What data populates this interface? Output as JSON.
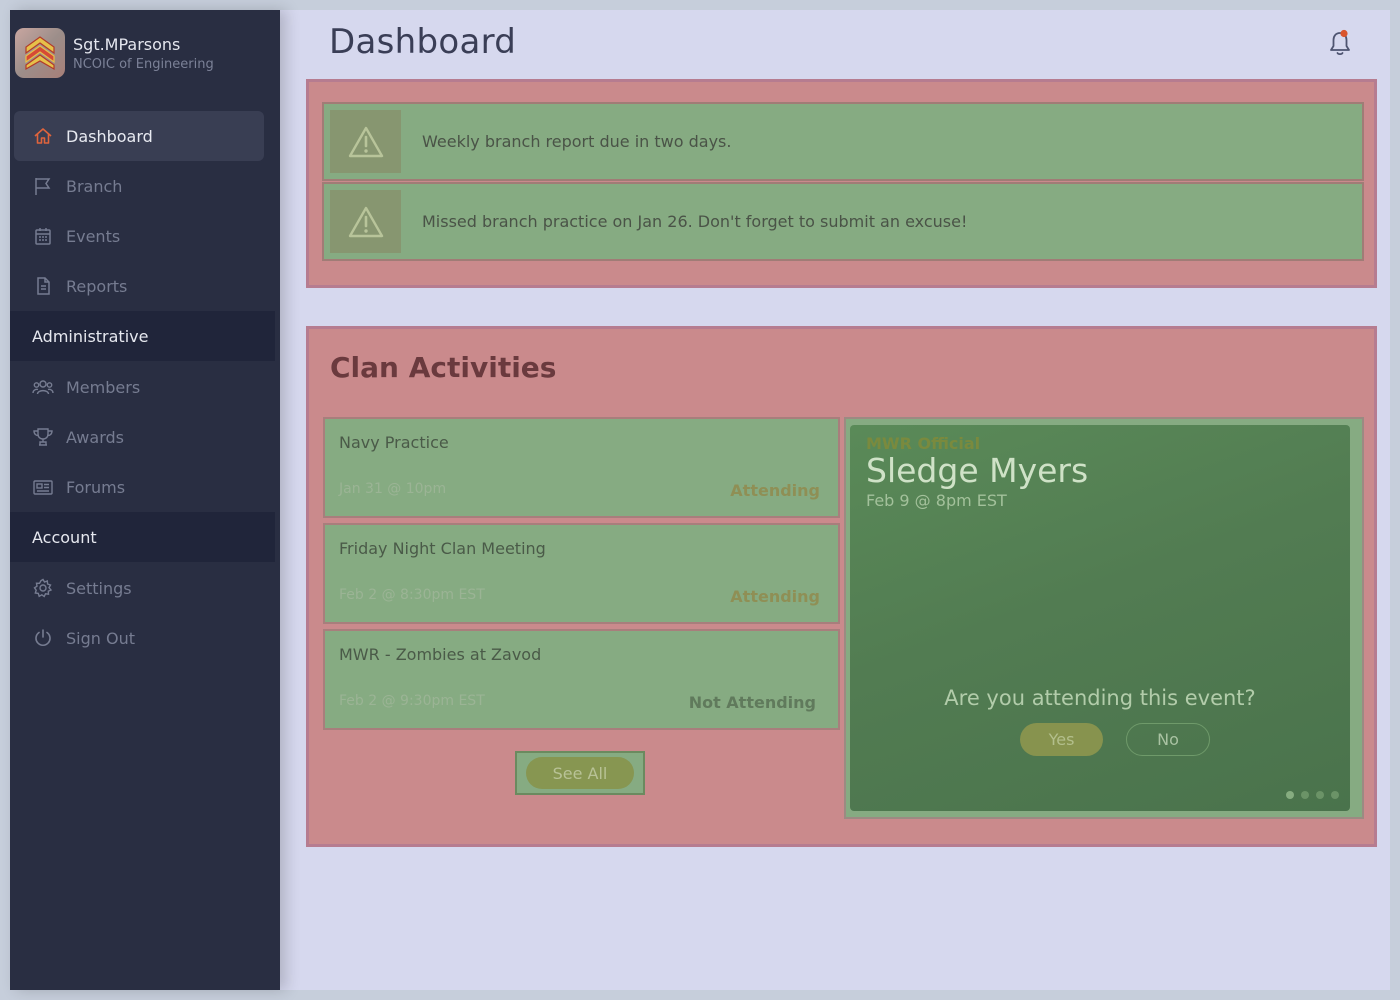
{
  "user": {
    "name": "Sgt.MParsons",
    "role": "NCOIC of Engineering"
  },
  "nav": {
    "main": [
      {
        "label": "Dashboard",
        "icon": "home-icon",
        "active": true
      },
      {
        "label": "Branch",
        "icon": "flag-icon"
      },
      {
        "label": "Events",
        "icon": "calendar-icon"
      },
      {
        "label": "Reports",
        "icon": "document-icon"
      }
    ],
    "administrative_header": "Administrative",
    "administrative": [
      {
        "label": "Members",
        "icon": "users-icon"
      },
      {
        "label": "Awards",
        "icon": "trophy-icon"
      },
      {
        "label": "Forums",
        "icon": "newspaper-icon"
      }
    ],
    "account_header": "Account",
    "account": [
      {
        "label": "Settings",
        "icon": "gear-icon"
      },
      {
        "label": "Sign Out",
        "icon": "power-icon"
      }
    ]
  },
  "page": {
    "title": "Dashboard"
  },
  "alerts": [
    {
      "text": "Weekly branch report due in two days.",
      "icon": "warning-icon"
    },
    {
      "text": "Missed branch practice on Jan 26. Don't forget to submit an excuse!",
      "icon": "warning-icon"
    }
  ],
  "activities": {
    "title": "Clan Activities",
    "events": [
      {
        "name": "Navy Practice",
        "date": "Jan 31 @ 10pm",
        "status": "Attending"
      },
      {
        "name": "Friday Night Clan Meeting",
        "date": "Feb 2 @ 8:30pm EST",
        "status": "Attending"
      },
      {
        "name": "MWR - Zombies at Zavod",
        "date": "Feb 2 @ 9:30pm EST",
        "status": "Not Attending"
      }
    ],
    "see_all_label": "See All",
    "featured": {
      "tag": "MWR Official",
      "title": "Sledge Myers",
      "date": "Feb 9 @ 8pm EST",
      "question": "Are you attending this event?",
      "yes_label": "Yes",
      "no_label": "No",
      "slide_count": 4,
      "active_slide": 1
    }
  },
  "colors": {
    "sidebar": "#292e42",
    "accent_active": "#e0643c",
    "notification_dot": "#d9542c"
  }
}
